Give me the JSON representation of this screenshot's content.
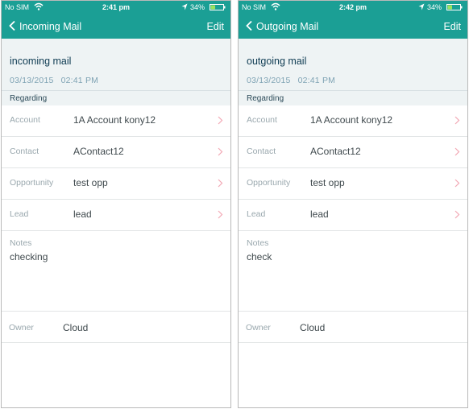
{
  "colors": {
    "accent": "#1b9f95",
    "header_bg": "#eef3f4",
    "chevron": "#f2a7b4"
  },
  "screens": [
    {
      "status": {
        "carrier": "No SIM",
        "time": "2:41 pm",
        "battery": "34%"
      },
      "nav": {
        "title": "Incoming Mail",
        "edit": "Edit"
      },
      "header": {
        "subject": "incoming mail",
        "date": "03/13/2015",
        "time": "02:41 PM"
      },
      "section": "Regarding",
      "fields": {
        "account": {
          "label": "Account",
          "value": "1A Account kony12"
        },
        "contact": {
          "label": "Contact",
          "value": "AContact12"
        },
        "opportunity": {
          "label": "Opportunity",
          "value": "test opp"
        },
        "lead": {
          "label": "Lead",
          "value": "lead"
        }
      },
      "notes": {
        "label": "Notes",
        "value": "checking"
      },
      "owner": {
        "label": "Owner",
        "value": "Cloud"
      }
    },
    {
      "status": {
        "carrier": "No SIM",
        "time": "2:42 pm",
        "battery": "34%"
      },
      "nav": {
        "title": "Outgoing Mail",
        "edit": "Edit"
      },
      "header": {
        "subject": "outgoing mail",
        "date": "03/13/2015",
        "time": "02:41 PM"
      },
      "section": "Regarding",
      "fields": {
        "account": {
          "label": "Account",
          "value": "1A Account kony12"
        },
        "contact": {
          "label": "Contact",
          "value": "AContact12"
        },
        "opportunity": {
          "label": "Opportunity",
          "value": "test opp"
        },
        "lead": {
          "label": "Lead",
          "value": "lead"
        }
      },
      "notes": {
        "label": "Notes",
        "value": "check"
      },
      "owner": {
        "label": "Owner",
        "value": "Cloud"
      }
    }
  ]
}
